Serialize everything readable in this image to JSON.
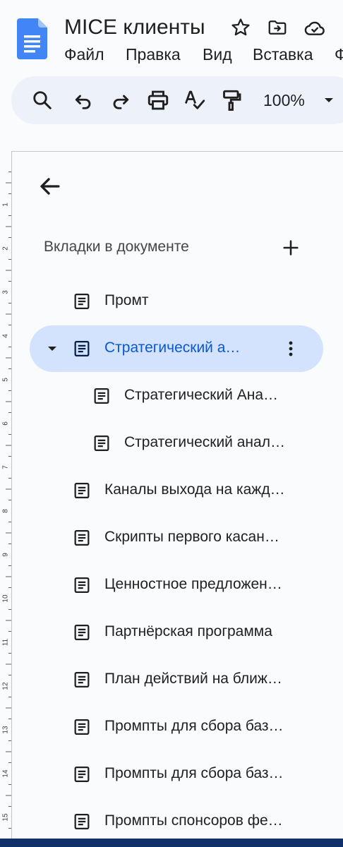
{
  "document": {
    "title": "MICE клиенты"
  },
  "menu": [
    {
      "label": "Файл"
    },
    {
      "label": "Правка"
    },
    {
      "label": "Вид"
    },
    {
      "label": "Вставка"
    },
    {
      "label": "Ф"
    }
  ],
  "toolbar": {
    "zoom": "100%"
  },
  "tabs_panel": {
    "heading": "Вкладки в документе",
    "tabs": [
      {
        "label": "Промт",
        "level": 0,
        "active": false
      },
      {
        "label": "Стратегический а…",
        "level": 0,
        "active": true
      },
      {
        "label": "Стратегический Ана…",
        "level": 1,
        "active": false
      },
      {
        "label": "Стратегический анал…",
        "level": 1,
        "active": false
      },
      {
        "label": "Каналы выхода на кажд…",
        "level": 0,
        "active": false
      },
      {
        "label": "Скрипты первого касан…",
        "level": 0,
        "active": false
      },
      {
        "label": "Ценностное предложен…",
        "level": 0,
        "active": false
      },
      {
        "label": "Партнёрская  программа",
        "level": 0,
        "active": false
      },
      {
        "label": "План действий на ближ…",
        "level": 0,
        "active": false
      },
      {
        "label": "Промпты для сбора баз…",
        "level": 0,
        "active": false
      },
      {
        "label": "Промпты для сбора баз…",
        "level": 0,
        "active": false
      },
      {
        "label": "Промпты спонсоров фе…",
        "level": 0,
        "active": false
      }
    ]
  },
  "ruler": {
    "labels": [
      "1",
      "2",
      "3",
      "4",
      "5",
      "6",
      "7",
      "8",
      "9",
      "10",
      "11",
      "12",
      "13",
      "14",
      "15"
    ]
  },
  "colors": {
    "accent": "#0b57d0",
    "active_tab_bg": "#d3e3fd",
    "toolbar_bg": "#edf2fa",
    "docs_blue": "#4285f4",
    "bottom_bar": "#10306a"
  }
}
